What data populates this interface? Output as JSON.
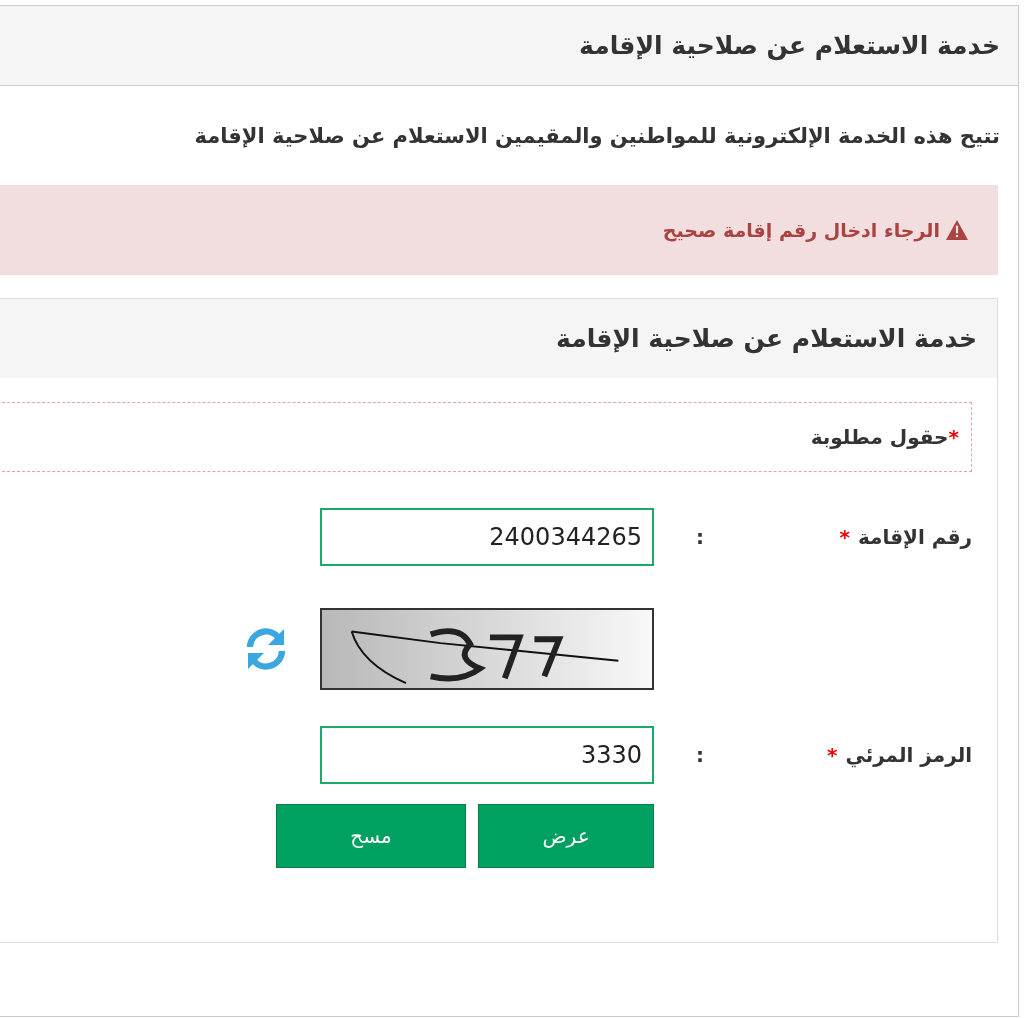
{
  "panel": {
    "title": "خدمة الاستعلام عن صلاحية الإقامة"
  },
  "description": "تتيح هذه الخدمة الإلكترونية للمواطنين والمقيمين الاستعلام عن صلاحية الإقامة",
  "alert": {
    "message": "الرجاء ادخال رقم إقامة صحيح"
  },
  "form": {
    "title": "خدمة الاستعلام عن صلاحية الإقامة",
    "required_note": {
      "mark": "*",
      "text": "حقول مطلوبة"
    },
    "rows": [
      {
        "kind": "field",
        "label": "رقم الإقامة",
        "mark": "*",
        "separator": ":",
        "value": "2400344265"
      },
      {
        "kind": "captcha"
      },
      {
        "kind": "field",
        "label": "الرمز المرئي",
        "mark": "*",
        "separator": ":",
        "value": "3330"
      }
    ],
    "buttons": [
      "عرض",
      "مسح"
    ]
  }
}
